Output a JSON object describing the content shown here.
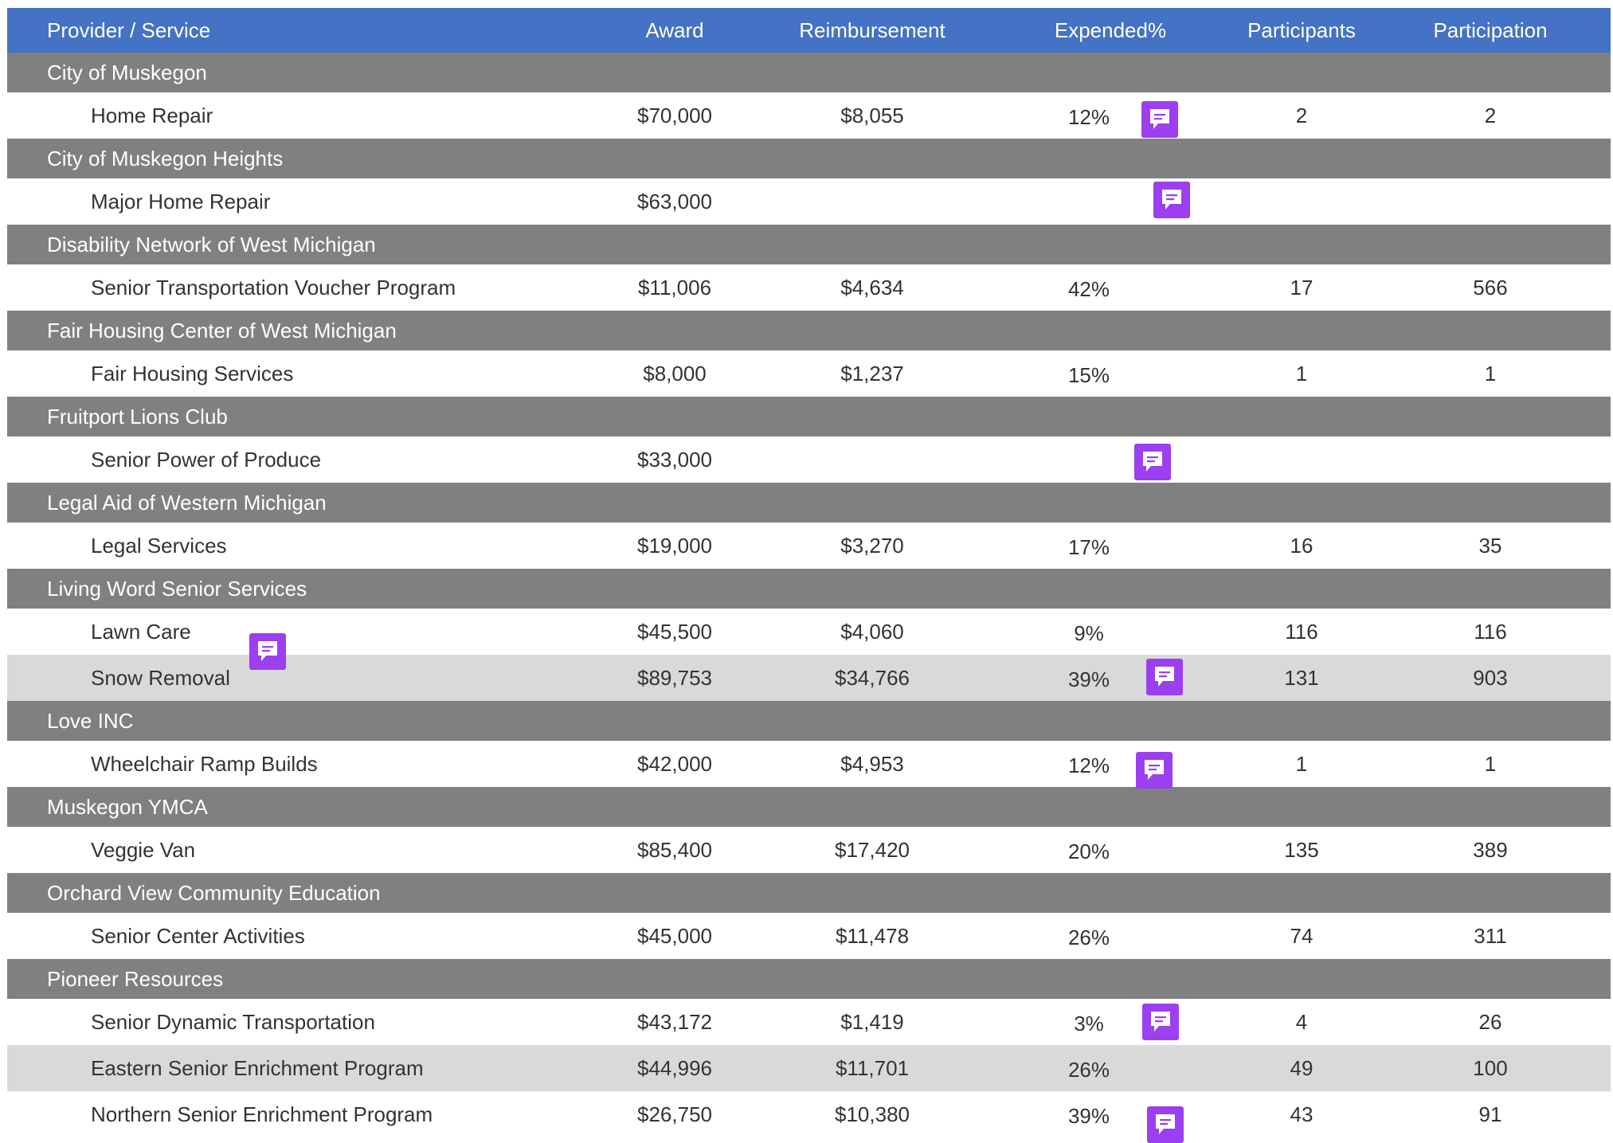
{
  "header": {
    "provider": "Provider / Service",
    "award": "Award",
    "reimbursement": "Reimbursement",
    "expended": "Expended%",
    "participants": "Participants",
    "participation": "Participation"
  },
  "groups": [
    {
      "name": "City of Muskegon",
      "services": [
        {
          "name": "Home Repair",
          "award": "$70,000",
          "reimbursement": "$8,055",
          "expended": "12%",
          "participants": "2",
          "participation": "2"
        }
      ]
    },
    {
      "name": "City of Muskegon Heights",
      "services": [
        {
          "name": "Major Home Repair",
          "award": "$63,000",
          "reimbursement": "",
          "expended": "",
          "participants": "",
          "participation": ""
        }
      ]
    },
    {
      "name": "Disability Network of West Michigan",
      "services": [
        {
          "name": "Senior Transportation Voucher Program",
          "award": "$11,006",
          "reimbursement": "$4,634",
          "expended": "42%",
          "participants": "17",
          "participation": "566"
        }
      ]
    },
    {
      "name": "Fair Housing Center of West Michigan",
      "services": [
        {
          "name": "Fair Housing Services",
          "award": "$8,000",
          "reimbursement": "$1,237",
          "expended": "15%",
          "participants": "1",
          "participation": "1"
        }
      ]
    },
    {
      "name": "Fruitport Lions Club",
      "services": [
        {
          "name": "Senior Power of Produce",
          "award": "$33,000",
          "reimbursement": "",
          "expended": "",
          "participants": "",
          "participation": ""
        }
      ]
    },
    {
      "name": "Legal Aid of Western Michigan",
      "services": [
        {
          "name": "Legal Services",
          "award": "$19,000",
          "reimbursement": "$3,270",
          "expended": "17%",
          "participants": "16",
          "participation": "35"
        }
      ]
    },
    {
      "name": "Living Word Senior Services",
      "services": [
        {
          "name": "Lawn Care",
          "award": "$45,500",
          "reimbursement": "$4,060",
          "expended": "9%",
          "participants": "116",
          "participation": "116"
        },
        {
          "name": "Snow Removal",
          "award": "$89,753",
          "reimbursement": "$34,766",
          "expended": "39%",
          "participants": "131",
          "participation": "903"
        }
      ]
    },
    {
      "name": "Love INC",
      "services": [
        {
          "name": "Wheelchair Ramp Builds",
          "award": "$42,000",
          "reimbursement": "$4,953",
          "expended": "12%",
          "participants": "1",
          "participation": "1"
        }
      ]
    },
    {
      "name": "Muskegon YMCA",
      "services": [
        {
          "name": "Veggie Van",
          "award": "$85,400",
          "reimbursement": "$17,420",
          "expended": "20%",
          "participants": "135",
          "participation": "389"
        }
      ]
    },
    {
      "name": "Orchard View Community Education",
      "services": [
        {
          "name": "Senior Center Activities",
          "award": "$45,000",
          "reimbursement": "$11,478",
          "expended": "26%",
          "participants": "74",
          "participation": "311"
        }
      ]
    },
    {
      "name": "Pioneer Resources",
      "services": [
        {
          "name": "Senior Dynamic Transportation",
          "award": "$43,172",
          "reimbursement": "$1,419",
          "expended": "3%",
          "participants": "4",
          "participation": "26"
        },
        {
          "name": "Eastern Senior Enrichment Program",
          "award": "$44,996",
          "reimbursement": "$11,701",
          "expended": "26%",
          "participants": "49",
          "participation": "100"
        },
        {
          "name": "Northern Senior Enrichment Program",
          "award": "$26,750",
          "reimbursement": "$10,380",
          "expended": "39%",
          "participants": "43",
          "participation": "91"
        }
      ]
    }
  ],
  "colors": {
    "header_bg": "#4472c4",
    "group_bg": "#808080",
    "highlight_row_bg": "#d9d9d9",
    "comment_icon": "#9b3ff0"
  },
  "icons": {
    "comment": "comment-icon"
  }
}
